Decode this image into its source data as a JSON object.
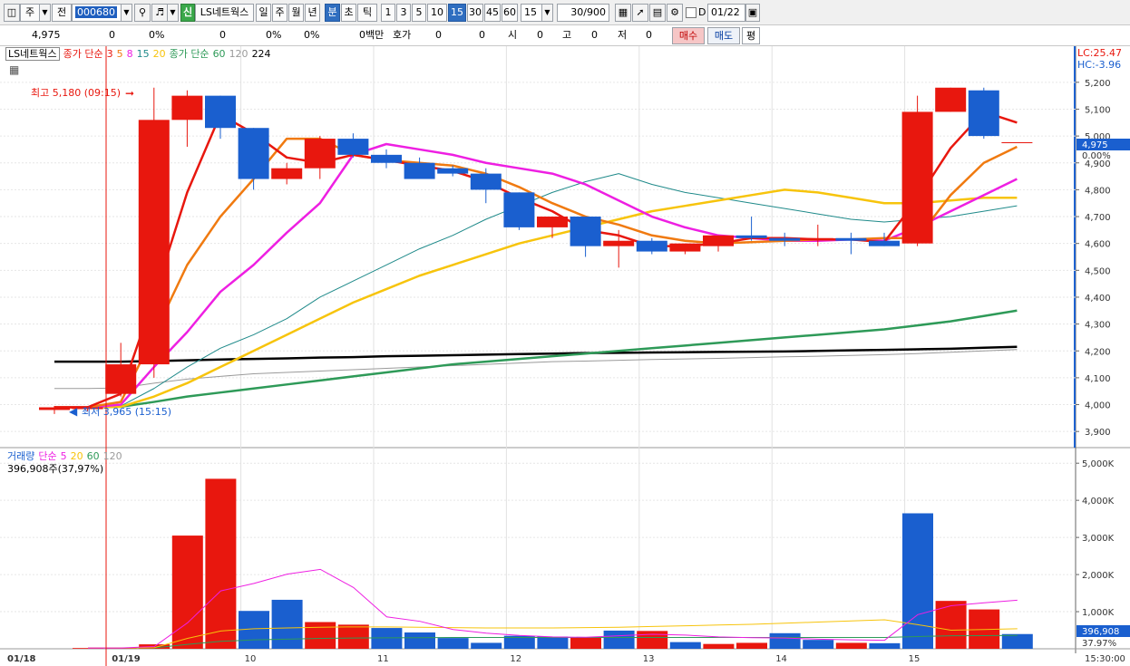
{
  "toolbar": {
    "market_label": "주",
    "prev_label": "전",
    "stock_code": "000680",
    "new_badge": "신",
    "stock_name": "LS네트웍스",
    "periods": [
      "일",
      "주",
      "월",
      "년",
      "분",
      "초",
      "틱"
    ],
    "active_period": "분",
    "intervals": [
      "1",
      "3",
      "5",
      "10",
      "15",
      "30",
      "45",
      "60"
    ],
    "active_interval": "15",
    "interval_value": "15",
    "count_value": "30",
    "count_max": "/900",
    "checkbox_label": "D",
    "date_value": "01/22"
  },
  "quote": {
    "price": "4,975",
    "change": "0",
    "change_pct": "0%",
    "volume": "0",
    "volume_pct": "0%",
    "vol_pct2": "0%",
    "amount": "0백만",
    "bid_label": "호가",
    "bid_value": "0",
    "bid_value2": "0",
    "open_label": "시",
    "open_value": "0",
    "high_label": "고",
    "high_value": "0",
    "low_label": "저",
    "low_value": "0",
    "buy_label": "매수",
    "sell_label": "매도",
    "avg_label": "평"
  },
  "chart_legend": {
    "name": "LS네트웍스",
    "ma_label": "종가 단순",
    "ma_short": [
      "3",
      "5",
      "8",
      "15",
      "20"
    ],
    "ma_label2": "종가 단순",
    "ma_long": [
      "60",
      "120",
      "224"
    ],
    "vol_label": "거래량",
    "vol_ma_label": "단순",
    "vol_ma": [
      "5",
      "20",
      "60",
      "120"
    ],
    "vol_current": "396,908주(37,97%)"
  },
  "annotations": {
    "high_marker": "최고 5,180 (09:15)",
    "low_marker": "최저 3,965 (15:15)",
    "lc": "LC:25.47",
    "hc": "HC:-3.96",
    "current_price_tag": "4,975",
    "current_pct_tag": "0.00%",
    "volume_tag": "396,908",
    "volume_pct_tag": "37.97%",
    "time_tag": "15:30:00"
  },
  "colors": {
    "up": "#e8170e",
    "down": "#1a5fcf",
    "ma3": "#e8170e",
    "ma5": "#f07a10",
    "ma8": "#ee1fe2",
    "ma15": "#1f8a8a",
    "ma20": "#f7c40c",
    "ma60": "#2e9a58",
    "ma120": "#9a9a9a",
    "ma224": "#000000"
  },
  "chart_data": [
    {
      "type": "candlestick",
      "x_axis_labels": [
        "01/18",
        "01/19",
        "10",
        "11",
        "12",
        "13",
        "14",
        "15"
      ],
      "ylim": [
        3850,
        5250
      ],
      "y_ticks": [
        "5,200",
        "5,100",
        "5,000",
        "4,900",
        "4,800",
        "4,700",
        "4,600",
        "4,500",
        "4,400",
        "4,300",
        "4,200",
        "4,100",
        "4,000",
        "3,900"
      ],
      "candles": [
        {
          "o": 3980,
          "h": 3995,
          "l": 3965,
          "c": 3990
        },
        {
          "o": 3985,
          "h": 3995,
          "l": 3975,
          "c": 3990
        },
        {
          "o": 4040,
          "h": 4230,
          "l": 4030,
          "c": 4150
        },
        {
          "o": 4150,
          "h": 5180,
          "l": 4100,
          "c": 5060
        },
        {
          "o": 5060,
          "h": 5170,
          "l": 4960,
          "c": 5150
        },
        {
          "o": 5150,
          "h": 5150,
          "l": 4990,
          "c": 5030
        },
        {
          "o": 5030,
          "h": 5030,
          "l": 4800,
          "c": 4840
        },
        {
          "o": 4840,
          "h": 4900,
          "l": 4820,
          "c": 4880
        },
        {
          "o": 4880,
          "h": 5000,
          "l": 4840,
          "c": 4990
        },
        {
          "o": 4990,
          "h": 5010,
          "l": 4920,
          "c": 4930
        },
        {
          "o": 4930,
          "h": 4950,
          "l": 4880,
          "c": 4900
        },
        {
          "o": 4900,
          "h": 4920,
          "l": 4850,
          "c": 4840
        },
        {
          "o": 4880,
          "h": 4890,
          "l": 4850,
          "c": 4860
        },
        {
          "o": 4860,
          "h": 4880,
          "l": 4750,
          "c": 4800
        },
        {
          "o": 4790,
          "h": 4790,
          "l": 4650,
          "c": 4660
        },
        {
          "o": 4660,
          "h": 4700,
          "l": 4620,
          "c": 4700
        },
        {
          "o": 4700,
          "h": 4700,
          "l": 4550,
          "c": 4590
        },
        {
          "o": 4590,
          "h": 4650,
          "l": 4510,
          "c": 4610
        },
        {
          "o": 4610,
          "h": 4620,
          "l": 4560,
          "c": 4570
        },
        {
          "o": 4570,
          "h": 4600,
          "l": 4560,
          "c": 4600
        },
        {
          "o": 4590,
          "h": 4630,
          "l": 4570,
          "c": 4630
        },
        {
          "o": 4630,
          "h": 4700,
          "l": 4610,
          "c": 4620
        },
        {
          "o": 4620,
          "h": 4640,
          "l": 4590,
          "c": 4610
        },
        {
          "o": 4620,
          "h": 4670,
          "l": 4590,
          "c": 4620
        },
        {
          "o": 4620,
          "h": 4640,
          "l": 4560,
          "c": 4610
        },
        {
          "o": 4610,
          "h": 4640,
          "l": 4590,
          "c": 4590
        },
        {
          "o": 4600,
          "h": 5150,
          "l": 4590,
          "c": 5090
        },
        {
          "o": 5090,
          "h": 5180,
          "l": 5090,
          "c": 5180
        },
        {
          "o": 5170,
          "h": 5180,
          "l": 4990,
          "c": 5000
        },
        {
          "o": 4975,
          "h": 4975,
          "l": 4975,
          "c": 4975
        }
      ],
      "ma3": [
        3990,
        3990,
        4040,
        4400,
        4790,
        5080,
        5010,
        4920,
        4900,
        4930,
        4910,
        4890,
        4870,
        4830,
        4770,
        4720,
        4650,
        4630,
        4590,
        4590,
        4600,
        4620,
        4620,
        4615,
        4615,
        4605,
        4765,
        4955,
        5090,
        5050
      ],
      "ma5": [
        3990,
        3990,
        4010,
        4260,
        4520,
        4700,
        4840,
        4990,
        4990,
        4930,
        4910,
        4900,
        4890,
        4860,
        4810,
        4750,
        4700,
        4670,
        4630,
        4610,
        4600,
        4605,
        4610,
        4615,
        4615,
        4620,
        4620,
        4780,
        4900,
        4960
      ],
      "ma8": [
        3990,
        3990,
        4000,
        4140,
        4270,
        4420,
        4520,
        4640,
        4750,
        4930,
        4970,
        4950,
        4930,
        4900,
        4880,
        4860,
        4820,
        4760,
        4700,
        4660,
        4630,
        4620,
        4610,
        4610,
        4615,
        4610,
        4660,
        4720,
        4780,
        4840
      ],
      "ma15": [
        3990,
        3990,
        3995,
        4060,
        4140,
        4210,
        4260,
        4320,
        4400,
        4460,
        4520,
        4580,
        4630,
        4690,
        4740,
        4790,
        4830,
        4860,
        4820,
        4790,
        4770,
        4750,
        4730,
        4710,
        4690,
        4680,
        4690,
        4700,
        4720,
        4740
      ],
      "ma20": [
        3990,
        3990,
        3992,
        4030,
        4080,
        4140,
        4200,
        4260,
        4320,
        4380,
        4430,
        4480,
        4520,
        4560,
        4600,
        4630,
        4660,
        4690,
        4720,
        4740,
        4760,
        4780,
        4800,
        4790,
        4770,
        4750,
        4750,
        4760,
        4770,
        4770
      ],
      "ma60": [
        3990,
        3990,
        3992,
        4010,
        4030,
        4045,
        4060,
        4075,
        4090,
        4105,
        4120,
        4135,
        4150,
        4160,
        4170,
        4180,
        4190,
        4200,
        4210,
        4220,
        4230,
        4240,
        4250,
        4260,
        4270,
        4280,
        4295,
        4310,
        4330,
        4350
      ],
      "ma120": [
        4060,
        4060,
        4062,
        4080,
        4095,
        4105,
        4115,
        4120,
        4125,
        4130,
        4135,
        4140,
        4145,
        4150,
        4155,
        4160,
        4162,
        4165,
        4168,
        4170,
        4172,
        4175,
        4178,
        4180,
        4183,
        4186,
        4190,
        4195,
        4200,
        4205
      ],
      "ma224": [
        4160,
        4160,
        4160,
        4162,
        4165,
        4168,
        4170,
        4172,
        4175,
        4177,
        4180,
        4182,
        4184,
        4186,
        4188,
        4190,
        4192,
        4193,
        4194,
        4195,
        4196,
        4197,
        4198,
        4200,
        4202,
        4204,
        4206,
        4208,
        4212,
        4215
      ]
    },
    {
      "type": "bar",
      "title": "거래량",
      "ylim": [
        0,
        5200
      ],
      "y_ticks": [
        "5,000K",
        "4,000K",
        "3,000K",
        "2,000K",
        "1,000K"
      ],
      "values": [
        20,
        10,
        120,
        3050,
        4580,
        1020,
        1320,
        720,
        650,
        560,
        440,
        290,
        160,
        350,
        330,
        310,
        490,
        480,
        180,
        130,
        160,
        420,
        240,
        160,
        150,
        3650,
        1290,
        1060,
        397
      ],
      "ma5": [
        20,
        20,
        60,
        700,
        1560,
        1760,
        2010,
        2140,
        1650,
        860,
        740,
        520,
        420,
        360,
        320,
        310,
        350,
        390,
        370,
        320,
        300,
        290,
        260,
        240,
        230,
        920,
        1160,
        1240,
        1310
      ],
      "ma20": [
        20,
        20,
        30,
        280,
        480,
        540,
        560,
        580,
        590,
        590,
        580,
        570,
        560,
        560,
        560,
        570,
        580,
        600,
        620,
        640,
        660,
        690,
        720,
        750,
        780,
        650,
        500,
        520,
        540
      ],
      "ma60": [
        20,
        20,
        25,
        120,
        200,
        240,
        260,
        280,
        290,
        295,
        300,
        305,
        305,
        305,
        305,
        305,
        305,
        305,
        305,
        305,
        305,
        305,
        305,
        305,
        305,
        330,
        350,
        355,
        360
      ]
    }
  ]
}
